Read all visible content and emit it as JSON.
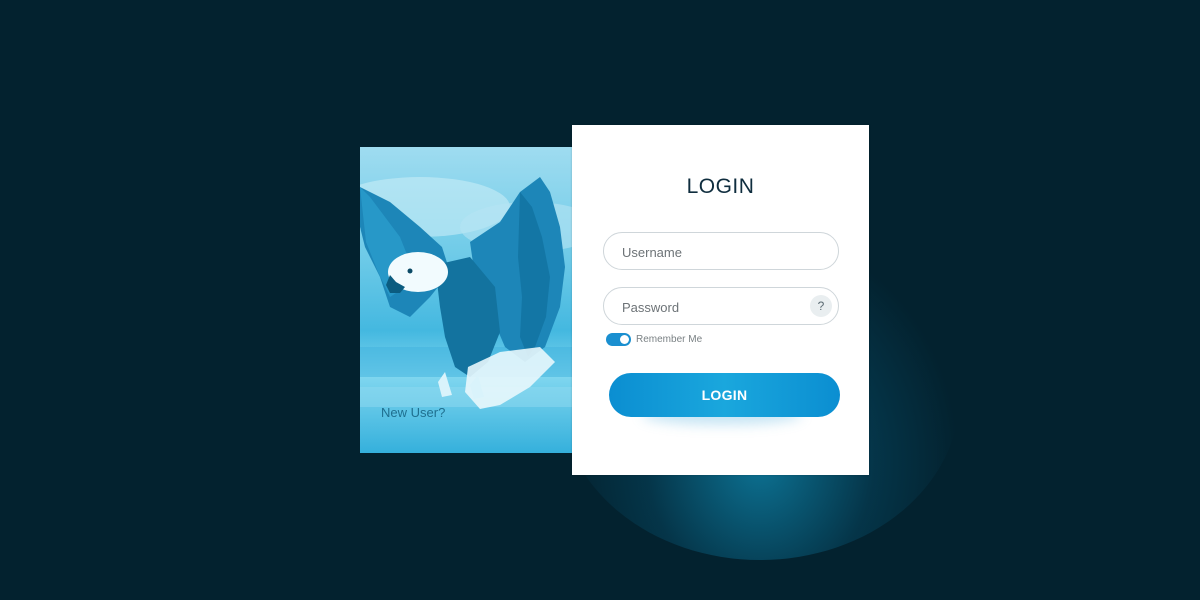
{
  "login": {
    "title": "LOGIN",
    "username_placeholder": "Username",
    "password_placeholder": "Password",
    "help_label": "?",
    "remember_label": "Remember Me",
    "remember_checked": true,
    "submit_label": "LOGIN"
  },
  "image_panel": {
    "new_user_label": "New User?",
    "image_subject": "bald-eagle"
  },
  "colors": {
    "background": "#03222f",
    "accent": "#0b8ed1",
    "card": "#ffffff",
    "title": "#0f2d3e"
  }
}
